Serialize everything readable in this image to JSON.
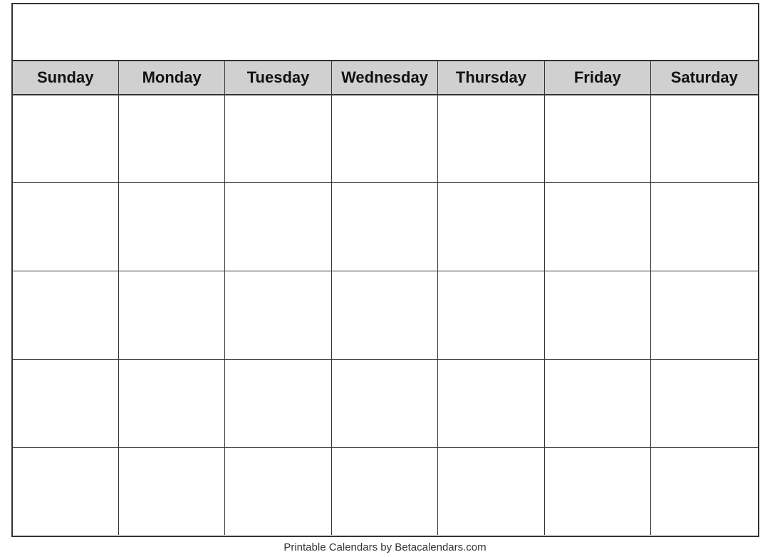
{
  "calendar": {
    "title": "",
    "days": [
      "Sunday",
      "Monday",
      "Tuesday",
      "Wednesday",
      "Thursday",
      "Friday",
      "Saturday"
    ],
    "weeks": [
      [
        "",
        "",
        "",
        "",
        "",
        "",
        ""
      ],
      [
        "",
        "",
        "",
        "",
        "",
        "",
        ""
      ],
      [
        "",
        "",
        "",
        "",
        "",
        "",
        ""
      ],
      [
        "",
        "",
        "",
        "",
        "",
        "",
        ""
      ],
      [
        "",
        "",
        "",
        "",
        "",
        "",
        ""
      ]
    ],
    "footer": "Printable Calendars by Betacalendars.com"
  }
}
